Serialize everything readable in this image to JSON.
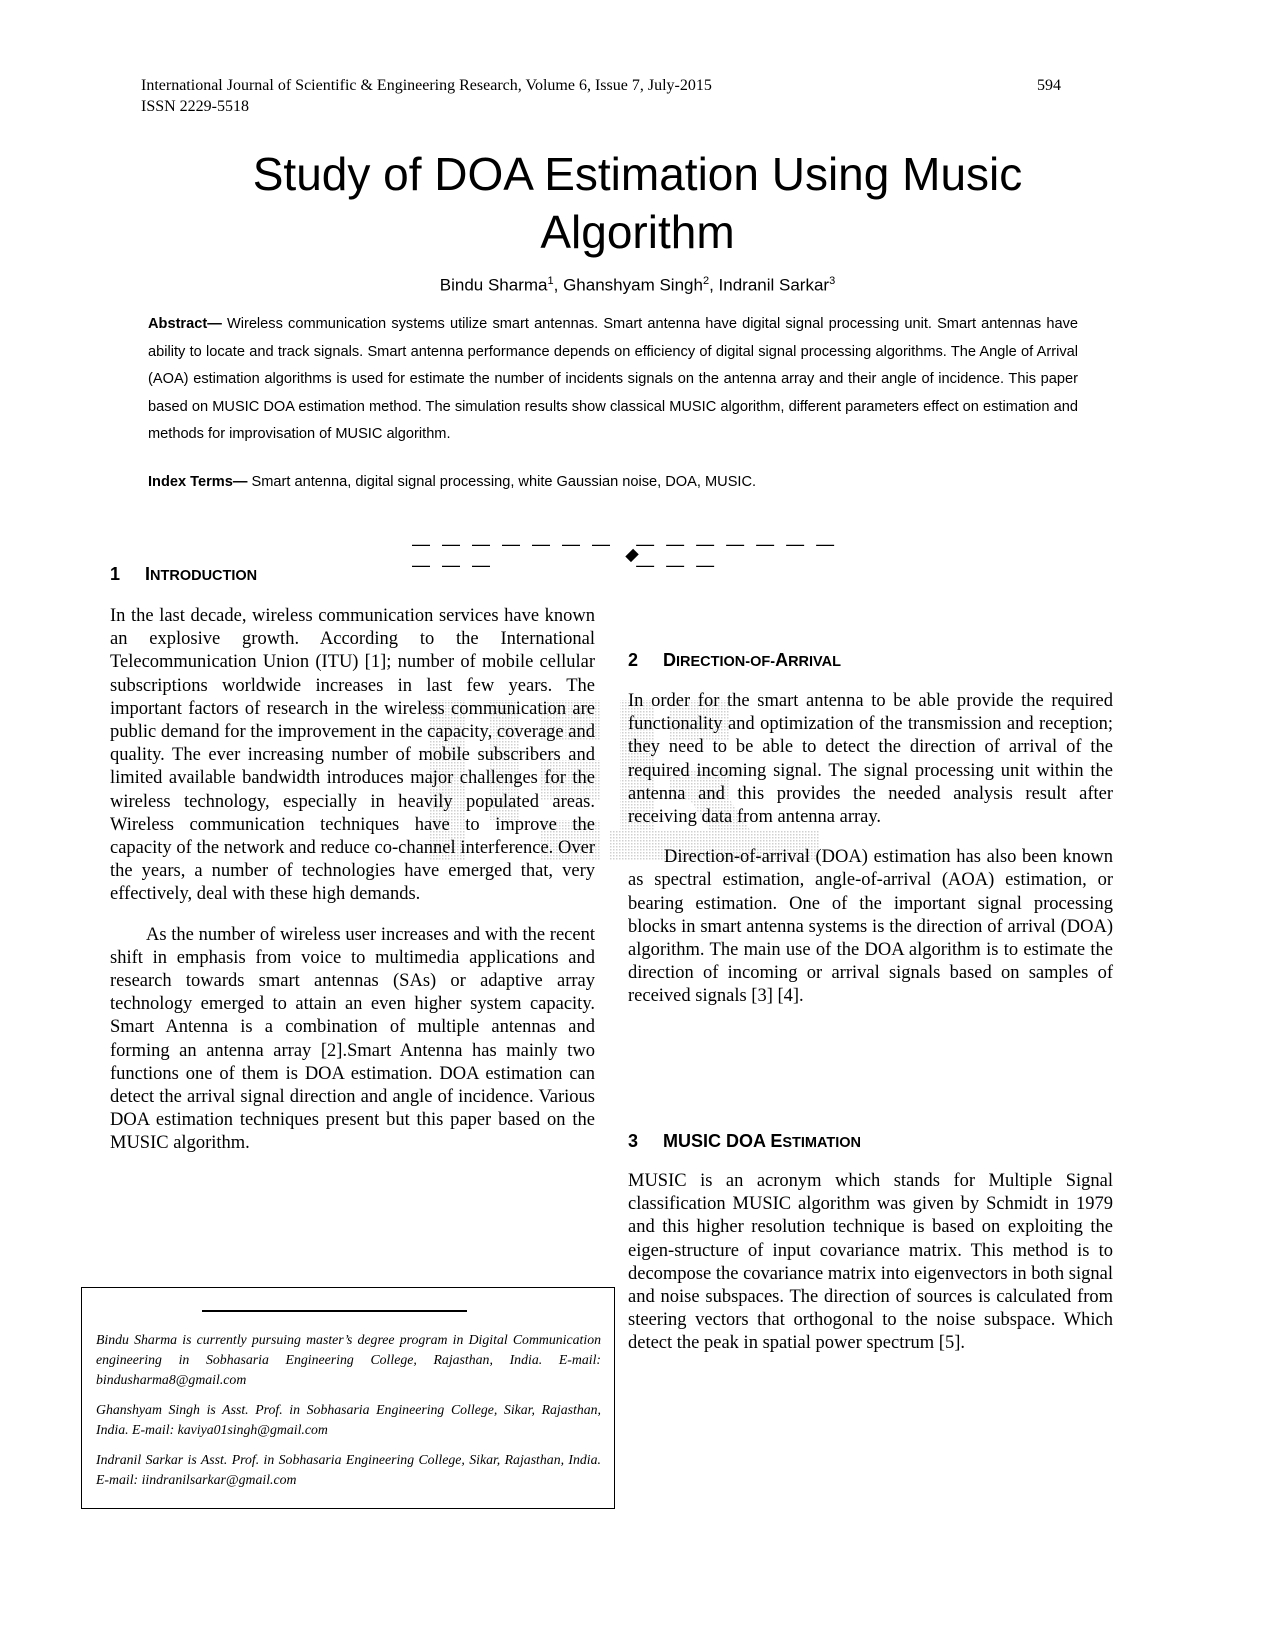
{
  "header": {
    "journal": "International Journal of Scientific & Engineering Research, Volume 6, Issue 7, July-2015",
    "issn": "ISSN 2229-5518",
    "page_number": "594"
  },
  "title_line1": "Study of DOA Estimation Using Music",
  "title_line2": "Algorithm",
  "authors": [
    {
      "name": "Bindu Sharma",
      "sup": "1"
    },
    {
      "name": "Ghanshyam Singh",
      "sup": "2"
    },
    {
      "name": "Indranil Sarkar",
      "sup": "3"
    }
  ],
  "abstract": {
    "label": "Abstract—",
    "text": " Wireless communication systems utilize smart antennas. Smart antenna have digital signal processing unit. Smart antennas have ability to locate and track signals. Smart antenna performance depends on efficiency of digital signal processing algorithms. The Angle of Arrival (AOA) estimation algorithms is used for estimate the number of incidents signals on the antenna array and their angle of incidence. This paper based on MUSIC DOA estimation method. The simulation results show classical MUSIC algorithm, different parameters effect on estimation and methods for improvisation of MUSIC algorithm."
  },
  "index_terms": {
    "label": "Index Terms—",
    "text": " Smart antenna, digital signal processing, white Gaussian noise, DOA, MUSIC."
  },
  "separator": {
    "left": "— — — — — — — — — —",
    "right": "— — — — — — — — — —"
  },
  "sections": {
    "intro": {
      "number": "1",
      "title_first": "I",
      "title_rest": "NTRODUCTION",
      "paragraphs": [
        "In the last decade, wireless communication services have known an explosive growth. According to the International Telecommunication Union (ITU) [1]; number of mobile cellular subscriptions worldwide increases in last few years. The important factors of research in the wireless communication are public demand for the improvement in the capacity, coverage and quality. The ever increasing number of mobile subscribers and limited available bandwidth introduces major challenges for the wireless technology, especially in heavily populated areas. Wireless communication techniques have to improve the capacity of the network and reduce co-channel interference. Over the years, a number of technologies have emerged that, very effectively, deal with these high demands.",
        "As the number of wireless user increases and with the recent shift in emphasis from voice to multimedia applications and research towards smart antennas (SAs) or adaptive array technology emerged to attain an even higher system capacity.  Smart Antenna is a combination of multiple antennas and forming an antenna array [2].Smart Antenna has mainly two functions one of them is DOA estimation. DOA estimation can detect the arrival signal direction and angle of incidence. Various DOA estimation techniques present but this paper based on the MUSIC algorithm."
      ]
    },
    "doa": {
      "number": "2",
      "title_parts": [
        "D",
        "IRECTION-OF-",
        "A",
        "RRIVAL"
      ],
      "paragraphs": [
        "In order for the smart antenna to be able provide the required functionality and optimization of the transmission and reception; they need to be able to detect the direction of arrival of the required incoming signal. The signal processing unit within the antenna and this provides the needed analysis result after receiving data from antenna array.",
        "Direction-of-arrival (DOA) estimation has also been known as spectral estimation, angle-of-arrival (AOA) estimation, or bearing estimation. One of the important signal processing blocks in smart antenna systems is the direction of arrival (DOA) algorithm. The main use of the DOA algorithm is to estimate the direction of incoming or arrival signals based on samples of received signals [3] [4]."
      ]
    },
    "music": {
      "number": "3",
      "title_main": "MUSIC DOA E",
      "title_rest": "STIMATION",
      "paragraphs": [
        "MUSIC is an acronym which stands for Multiple Signal classification MUSIC algorithm was given by Schmidt in 1979 and this higher resolution technique is based on exploiting the eigen-structure of input covariance matrix. This method is to decompose the covariance matrix into eigenvectors in both signal and noise subspaces. The direction of sources is calculated from steering vectors that orthogonal to the noise subspace. Which detect the peak in spatial power spectrum [5]."
      ]
    }
  },
  "footnotes": [
    "Bindu Sharma is currently pursuing master’s degree program in Digital Communication engineering in Sobhasaria Engineering College, Rajasthan, India. E-mail: bindusharma8@gmail.com",
    "Ghanshyam Singh is Asst. Prof. in Sobhasaria Engineering College, Sikar, Rajasthan, India. E-mail: kaviya01singh@gmail.com",
    "Indranil Sarkar is Asst. Prof. in Sobhasaria Engineering College, Sikar, Rajasthan, India. E-mail: iindranilsarkar@gmail.com"
  ]
}
